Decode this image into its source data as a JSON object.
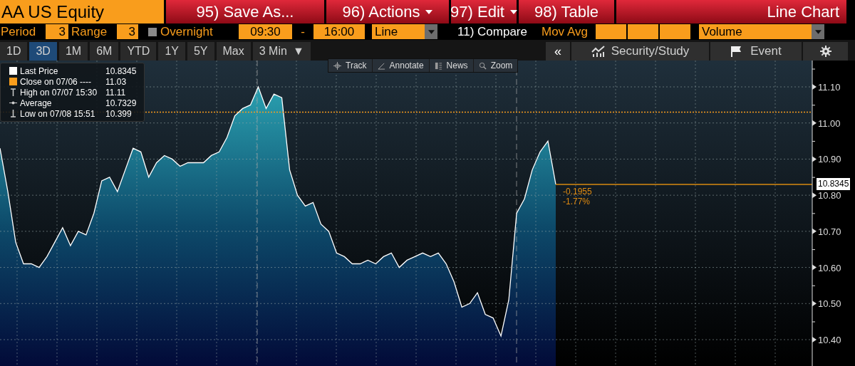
{
  "security": "AA US Equity",
  "menu_buttons": [
    {
      "label": "95) Save As...",
      "dropdown": false
    },
    {
      "label": "96) Actions",
      "dropdown": true
    },
    {
      "label": "97) Edit",
      "dropdown": true
    },
    {
      "label": "98) Table",
      "dropdown": false
    }
  ],
  "view_title": "Line Chart",
  "settings": {
    "period_label": "Period",
    "period": "3",
    "range_label": "Range",
    "range": "3",
    "overnight": {
      "label": "Overnight",
      "checked": false
    },
    "start_time": "09:30",
    "separator": "-",
    "end_time": "16:00",
    "chart_type": "Line",
    "compare": "11) Compare",
    "mov_avg_label": "Mov Avg",
    "volume": "Volume"
  },
  "tabs": [
    {
      "label": "1D",
      "selected": false
    },
    {
      "label": "3D",
      "selected": true
    },
    {
      "label": "1M",
      "selected": false
    },
    {
      "label": "6M",
      "selected": false
    },
    {
      "label": "YTD",
      "selected": false
    },
    {
      "label": "1Y",
      "selected": false
    },
    {
      "label": "5Y",
      "selected": false
    },
    {
      "label": "Max",
      "selected": false
    }
  ],
  "interval": {
    "label": "3 Min",
    "caret": "▼"
  },
  "right_tools": {
    "collapse": "«",
    "security_study": "Security/Study",
    "event": "Event"
  },
  "chart_toolbar": [
    {
      "kind": "track",
      "label": "Track"
    },
    {
      "kind": "annotate",
      "label": "Annotate"
    },
    {
      "kind": "news",
      "label": "News"
    },
    {
      "kind": "zoom",
      "label": "Zoom"
    }
  ],
  "legend": [
    {
      "kind": "last",
      "value": "10.8345"
    },
    {
      "kind": "close",
      "label": "Close on 07/06 ----"
    },
    {
      "kind": "high",
      "label": "High on 07/07 15:30",
      "value": "11.11"
    },
    {
      "kind": "average",
      "label": "Average",
      "value": "10.7329"
    },
    {
      "kind": "low",
      "label": "Low on 07/08 15:51",
      "value": "10.399"
    }
  ],
  "chart": {
    "last_label": "10.8345",
    "change": "-0.1955",
    "change_pct": "-1.77%",
    "chart_data": {
      "type": "area",
      "ylim": [
        10.327,
        11.173
      ],
      "yticks": [
        {
          "value": 10.4,
          "label": "10.40"
        },
        {
          "value": 10.5,
          "label": "10.50"
        },
        {
          "value": 10.6,
          "label": "10.60"
        },
        {
          "value": 10.7,
          "label": "10.70"
        },
        {
          "value": 10.8,
          "label": "10.80"
        },
        {
          "value": 10.9,
          "label": "10.90"
        },
        {
          "value": 11.0,
          "label": "11.00"
        },
        {
          "value": 11.1,
          "label": "11.10"
        }
      ],
      "grid": true,
      "ref_lines": [
        {
          "axis": "y",
          "value": 11.03,
          "label": "11.03",
          "color": "#f99d1c"
        }
      ],
      "series": [
        {
          "name": "Last Price",
          "color": "#ffffff",
          "values": [
            10.93,
            10.81,
            10.67,
            10.61,
            10.61,
            10.6,
            10.63,
            10.67,
            10.71,
            10.66,
            10.7,
            10.69,
            10.75,
            10.84,
            10.85,
            10.81,
            10.87,
            10.93,
            10.92,
            10.85,
            10.89,
            10.91,
            10.9,
            10.88,
            10.89,
            10.89,
            10.89,
            10.91,
            10.92,
            10.96,
            11.02,
            11.04,
            11.05,
            11.1,
            11.04,
            11.08,
            11.07,
            10.87,
            10.8,
            10.77,
            10.78,
            10.72,
            10.7,
            10.64,
            10.63,
            10.61,
            10.61,
            10.62,
            10.61,
            10.63,
            10.64,
            10.6,
            10.62,
            10.63,
            10.64,
            10.63,
            10.64,
            10.61,
            10.56,
            10.49,
            10.5,
            10.53,
            10.47,
            10.46,
            10.41,
            10.51,
            10.75,
            10.79,
            10.87,
            10.92,
            10.95,
            10.83
          ]
        }
      ]
    }
  }
}
